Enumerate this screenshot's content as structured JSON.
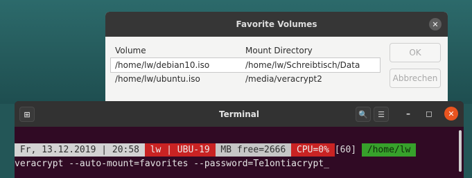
{
  "dialog": {
    "title": "Favorite Volumes",
    "columns": {
      "volume": "Volume",
      "mount": "Mount Directory"
    },
    "rows": [
      {
        "volume": "/home/lw/debian10.iso",
        "mount": "/home/lw/Schreibtisch/Data"
      },
      {
        "volume": "/home/lw/ubuntu.iso",
        "mount": "/media/veracrypt2"
      }
    ],
    "ok_label": "OK",
    "cancel_label": "Abbrechen",
    "close_glyph": "✕"
  },
  "terminal": {
    "title": "Terminal",
    "newtab_glyph": "⊞",
    "search_glyph": "🔍",
    "menu_glyph": "☰",
    "minimize_glyph": "–",
    "maximize_glyph": "◻",
    "close_glyph": "✕",
    "prompt": {
      "date": " Fr, 13.12.2019 | 20:58 ",
      "user": " lw | UBU-19 ",
      "free": " MB free=2666 ",
      "cpu": " CPU=0% ",
      "num": "[60] ",
      "path": " /home/lw "
    },
    "command": "veracrypt --auto-mount=favorites --password=Te1ontiacrypt_"
  },
  "colors": {
    "desktop": "#235657",
    "terminal_bg": "#300a24",
    "prompt_red": "#c92323",
    "prompt_green": "#37a12b",
    "close_orange": "#e9541f"
  },
  "icons": [
    "close-icon",
    "new-tab-icon",
    "search-icon",
    "menu-icon",
    "minimize-icon",
    "maximize-icon"
  ]
}
